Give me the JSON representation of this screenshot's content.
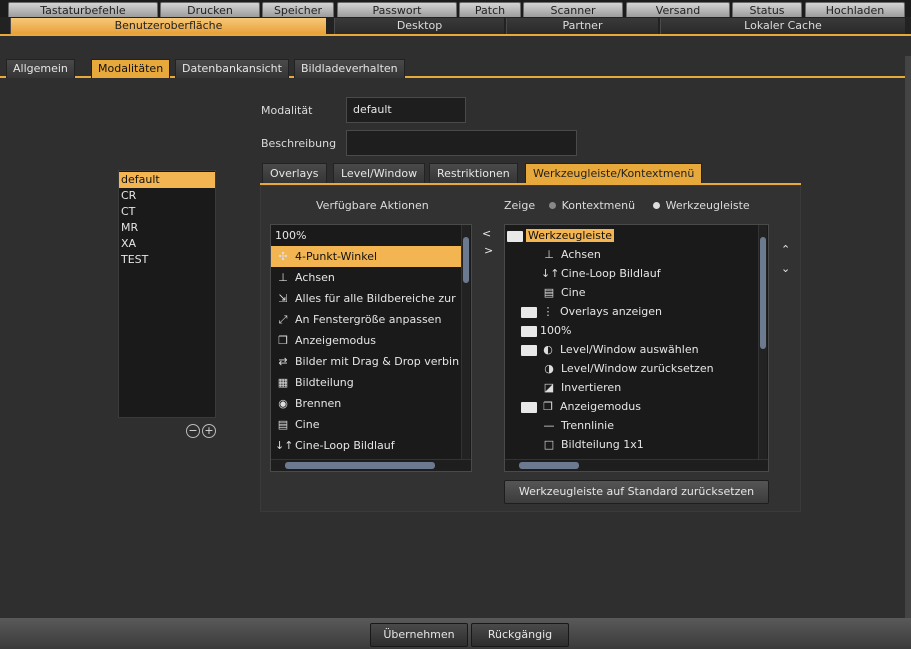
{
  "top_tabs": [
    "Tastaturbefehle",
    "Drucken",
    "Speicher",
    "Passwort",
    "Patch",
    "Scanner",
    "Versand",
    "Status",
    "Hochladen"
  ],
  "second_tabs": [
    {
      "label": "Benutzeroberfläche",
      "selected": true
    },
    {
      "label": "Desktop",
      "selected": false
    },
    {
      "label": "Partner",
      "selected": false
    },
    {
      "label": "Lokaler Cache",
      "selected": false
    }
  ],
  "sub_tabs": [
    {
      "label": "Allgemein",
      "selected": false
    },
    {
      "label": "Modalitäten",
      "selected": true
    },
    {
      "label": "Datenbankansicht",
      "selected": false
    },
    {
      "label": "Bildladeverhalten",
      "selected": false
    }
  ],
  "form": {
    "modality_label": "Modalität",
    "modality_value": "default",
    "description_label": "Beschreibung",
    "description_value": ""
  },
  "modalities": [
    "default",
    "CR",
    "CT",
    "MR",
    "XA",
    "TEST"
  ],
  "modality_selected": 0,
  "remove_icon": "−",
  "add_icon": "+",
  "inner_tabs": [
    {
      "label": "Overlays",
      "selected": false
    },
    {
      "label": "Level/Window",
      "selected": false
    },
    {
      "label": "Restriktionen",
      "selected": false
    },
    {
      "label": "Werkzeugleiste/Kontextmenü",
      "selected": true
    }
  ],
  "available": {
    "header": "Verfügbare Aktionen",
    "items": [
      {
        "label": "100%",
        "icon": "none"
      },
      {
        "label": "4-Punkt-Winkel",
        "icon": "angle-icon",
        "selected": true
      },
      {
        "label": "Achsen",
        "icon": "axes-icon"
      },
      {
        "label": "Alles für alle Bildbereiche zur",
        "icon": "reset-all-icon"
      },
      {
        "label": "An Fenstergröße anpassen",
        "icon": "fit-icon"
      },
      {
        "label": "Anzeigemodus",
        "icon": "display-mode-icon"
      },
      {
        "label": "Bilder mit Drag & Drop verbin",
        "icon": "drag-drop-icon"
      },
      {
        "label": "Bildteilung",
        "icon": "grid-icon"
      },
      {
        "label": "Brennen",
        "icon": "burn-icon"
      },
      {
        "label": "Cine",
        "icon": "cine-icon"
      },
      {
        "label": "Cine-Loop Bildlauf",
        "icon": "cine-loop-icon"
      }
    ]
  },
  "show": {
    "label": "Zeige",
    "option_context": "Kontextmenü",
    "option_toolbar": "Werkzeugleiste",
    "selected": "toolbar"
  },
  "tree": {
    "root": "Werkzeugleiste",
    "items": [
      {
        "label": "Achsen",
        "icon": "axes-icon",
        "folder": false
      },
      {
        "label": "Cine-Loop Bildlauf",
        "icon": "cine-loop-icon",
        "folder": false
      },
      {
        "label": "Cine",
        "icon": "cine-icon",
        "folder": false
      },
      {
        "label": "Overlays anzeigen",
        "icon": "overlay-icon",
        "folder": true
      },
      {
        "label": "100%",
        "icon": "none",
        "folder": true
      },
      {
        "label": "Level/Window auswählen",
        "icon": "level-window-icon",
        "folder": true
      },
      {
        "label": "Level/Window zurücksetzen",
        "icon": "level-reset-icon",
        "folder": false
      },
      {
        "label": "Invertieren",
        "icon": "invert-icon",
        "folder": false
      },
      {
        "label": "Anzeigemodus",
        "icon": "display-mode-icon",
        "folder": true
      },
      {
        "label": "Trennlinie",
        "icon": "separator-icon",
        "folder": false
      },
      {
        "label": "Bildteilung  1x1",
        "icon": "split-icon",
        "folder": false
      }
    ]
  },
  "reset_button": "Werkzeugleiste auf Standard zurücksetzen",
  "move_left": "<",
  "move_right": ">",
  "move_up": "^",
  "move_down": "v",
  "footer": {
    "apply": "Übernehmen",
    "undo": "Rückgängig"
  }
}
